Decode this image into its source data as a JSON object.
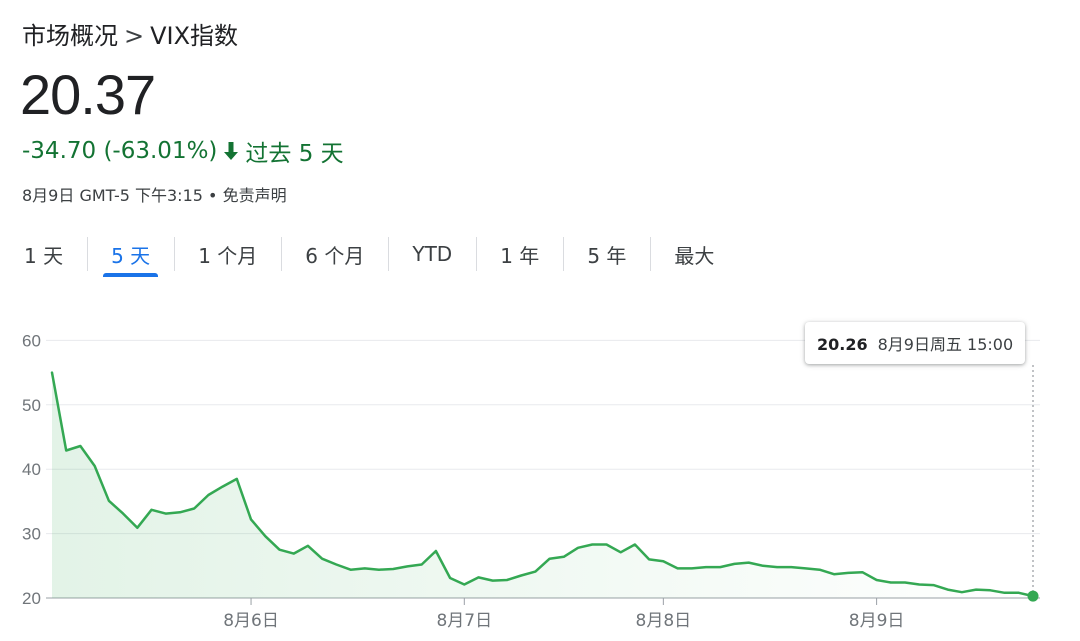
{
  "breadcrumb": {
    "parent": "市场概况",
    "separator": ">",
    "current": "VIX指数"
  },
  "quote": {
    "price": "20.37",
    "change": "-34.70 (-63.01%)",
    "period": "过去 5 天",
    "timestamp": "8月9日 GMT-5 下午3:15",
    "disclaimer": "免责声明"
  },
  "tabs": [
    {
      "label": "1 天",
      "active": false
    },
    {
      "label": "5 天",
      "active": true
    },
    {
      "label": "1 个月",
      "active": false
    },
    {
      "label": "6 个月",
      "active": false
    },
    {
      "label": "YTD",
      "active": false
    },
    {
      "label": "1 年",
      "active": false
    },
    {
      "label": "5 年",
      "active": false
    },
    {
      "label": "最大",
      "active": false
    }
  ],
  "tooltip": {
    "value": "20.26",
    "date": "8月9日周五 15:00"
  },
  "colors": {
    "line": "#34a853",
    "positive_negative_text": "#137333",
    "accent": "#1a73e8"
  },
  "chart_data": {
    "type": "line",
    "x_tick_labels": [
      "8月6日",
      "8月7日",
      "8月8日",
      "8月9日"
    ],
    "y_tick_labels": [
      "20",
      "30",
      "40",
      "50",
      "60"
    ],
    "ylim": [
      20,
      60
    ],
    "grid": true,
    "series": [
      {
        "values": [
          55.0,
          42.9,
          43.6,
          40.5,
          35.1,
          33.1,
          30.9,
          33.7,
          33.1,
          33.3,
          33.9,
          36.0,
          37.3,
          38.5,
          32.2,
          29.6,
          27.5,
          26.9,
          28.1,
          26.1,
          25.2,
          24.4,
          24.6,
          24.4,
          24.5,
          24.9,
          25.2,
          27.3,
          23.1,
          22.1,
          23.2,
          22.7,
          22.8,
          23.5,
          24.1,
          26.1,
          26.4,
          27.8,
          28.3,
          28.3,
          27.1,
          28.3,
          26.0,
          25.7,
          24.6,
          24.6,
          24.8,
          24.8,
          25.3,
          25.5,
          25.0,
          24.8,
          24.8,
          24.6,
          24.4,
          23.7,
          23.9,
          24.0,
          22.8,
          22.4,
          22.4,
          22.1,
          22.0,
          21.3,
          20.9,
          21.3,
          21.2,
          20.8,
          20.8,
          20.3
        ],
        "x_tick_indices": [
          14,
          29,
          43,
          58
        ]
      }
    ]
  }
}
